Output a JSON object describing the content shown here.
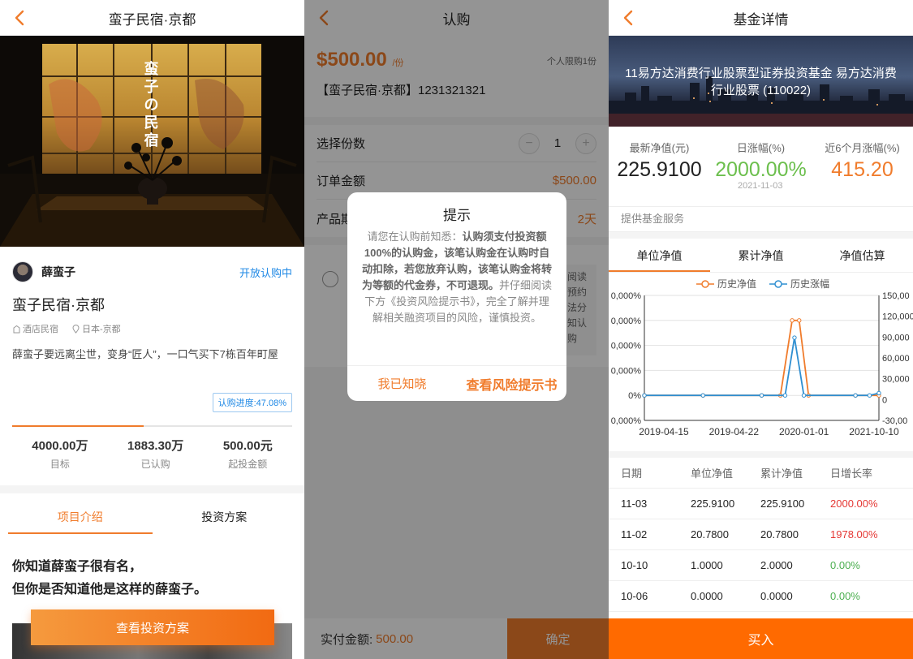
{
  "panel1": {
    "nav_title": "蛮子民宿·京都",
    "hero_brand_text": "蛮子の民宿",
    "host_name": "薛蛮子",
    "open_status": "开放认购中",
    "title": "蛮子民宿·京都",
    "tag_type": "酒店民宿",
    "tag_location": "日本-京都",
    "description": "薛蛮子要远离尘世，变身“匠人”，一口气买下7栋百年町屋",
    "progress_label": "认购进度:47.08%",
    "progress_fraction": 0.4708,
    "stats": [
      {
        "value": "4000.00万",
        "label": "目标"
      },
      {
        "value": "1883.30万",
        "label": "已认购"
      },
      {
        "value": "500.00元",
        "label": "起投金额"
      }
    ],
    "tabs": [
      "项目介绍",
      "投资方案"
    ],
    "intro_line1": "你知道薛蛮子很有名，",
    "intro_line2": "但你是否知道他是这样的薛蛮子。",
    "cta": "查看投资方案",
    "accent": "#f07c2c"
  },
  "panel2": {
    "nav_title": "认购",
    "price": "$500.00",
    "price_unit": "/份",
    "limit": "个人限购1份",
    "product": "【蛮子民宿·京都】1231321321",
    "rows": {
      "shares_label": "选择份数",
      "shares_value": "1",
      "minus": "−",
      "plus": "+",
      "order_label": "订单金额",
      "order_value": "$500.00",
      "term_label": "产品期限",
      "term_value": "2天"
    },
    "agree_snippet": "阅读预约法分知认购",
    "footer_pay_label": "实付金额:",
    "footer_pay_value": "500.00",
    "confirm": "确定",
    "dialog": {
      "title": "提示",
      "body_part1": "请您在认购前知悉：",
      "body_bold": "认购须支付投资额100%的认购金，该笔认购金在认购时自动扣除，若您放弃认购，该笔认购金将转为等额的代金券，不可退现。",
      "body_part2": "并仔细阅读下方《投资风险提示书》，完全了解并理解相关融资项目的风险，谨慎投资。",
      "btn_ok": "我已知晓",
      "btn_view": "查看风险提示书"
    }
  },
  "panel3": {
    "nav_title": "基金详情",
    "banner_title": "11易方达消费行业股票型证券投资基金 易方达消费行业股票 (110022)",
    "metrics": [
      {
        "label": "最新净值(元)",
        "value": "225.9100",
        "color": "#222222"
      },
      {
        "label": "日涨幅(%)",
        "value": "2000.00%",
        "color": "#6cbf4d"
      },
      {
        "label": "近6个月涨幅(%)",
        "value": "415.20",
        "color": "#f07c2c"
      }
    ],
    "metric_date": "2021-11-03",
    "service": "提供基金服务",
    "tabs": [
      "单位净值",
      "累计净值",
      "净值估算"
    ],
    "table_headers": [
      "日期",
      "单位净值",
      "累计净值",
      "日增长率"
    ],
    "table_rows": [
      {
        "date": "11-03",
        "unit": "225.9100",
        "acc": "225.9100",
        "growth": "2000.00%",
        "trend": "up"
      },
      {
        "date": "11-02",
        "unit": "20.7800",
        "acc": "20.7800",
        "growth": "1978.00%",
        "trend": "up"
      },
      {
        "date": "10-10",
        "unit": "1.0000",
        "acc": "2.0000",
        "growth": "0.00%",
        "trend": "flat"
      },
      {
        "date": "10-06",
        "unit": "0.0000",
        "acc": "0.0000",
        "growth": "0.00%",
        "trend": "flat"
      }
    ],
    "buy": "买入"
  },
  "chart_data": {
    "type": "line",
    "categories": [
      "2019-04-15",
      "2019-04-22",
      "2020-01-01",
      "2021-10-10"
    ],
    "legend": [
      "历史净值",
      "历史涨幅"
    ],
    "legend_position": "top",
    "y_left_ticks": [
      "0,000%",
      "0,000%",
      "0,000%",
      "0,000%",
      "0%",
      "0,000%"
    ],
    "y_right_ticks": [
      "150,00",
      "120,000",
      "90,000",
      "60,000",
      "30,000",
      "0",
      "-30,00"
    ],
    "series": [
      {
        "name": "历史净值",
        "color": "#f07c2c",
        "points": [
          [
            0,
            0
          ],
          [
            0.25,
            0
          ],
          [
            0.5,
            0
          ],
          [
            0.58,
            0
          ],
          [
            0.63,
            100
          ],
          [
            0.66,
            100
          ],
          [
            0.7,
            0
          ],
          [
            0.9,
            0
          ],
          [
            1,
            0
          ]
        ]
      },
      {
        "name": "历史涨幅",
        "color": "#2f8fd1",
        "points": [
          [
            0,
            0
          ],
          [
            0.25,
            0
          ],
          [
            0.5,
            0
          ],
          [
            0.6,
            0
          ],
          [
            0.64,
            77
          ],
          [
            0.68,
            0
          ],
          [
            0.9,
            0
          ],
          [
            0.96,
            0
          ],
          [
            1,
            3
          ]
        ]
      }
    ],
    "grid": true
  }
}
